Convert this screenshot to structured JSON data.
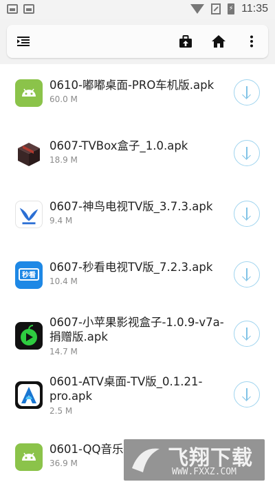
{
  "status_bar": {
    "time": "11:35",
    "battery_glyph": "⚡"
  },
  "toolbar": {
    "menu_icon": "menu-icon",
    "upload_icon": "upload-icon",
    "home_icon": "home-icon",
    "more_icon": "more-vertical-icon"
  },
  "files": [
    {
      "name": "0610-嘟嘟桌面-PRO车机版.apk",
      "size": "60.0 M",
      "icon": "android-icon"
    },
    {
      "name": "0607-TVBox盒子_1.0.apk",
      "size": "18.9 M",
      "icon": "box-icon"
    },
    {
      "name": "0607-神鸟电视TV版_3.7.3.apk",
      "size": "9.4 M",
      "icon": "bird-icon"
    },
    {
      "name": "0607-秒看电视TV版_7.2.3.apk",
      "size": "10.4 M",
      "icon": "tv-icon",
      "icon_text": "秒看"
    },
    {
      "name": "0607-小苹果影视盒子-1.0.9-v7a-捐赠版.apk",
      "size": "14.7 M",
      "icon": "apple-play-icon"
    },
    {
      "name": "0601-ATV桌面-TV版_0.1.21-pro.apk",
      "size": "2.5 M",
      "icon": "atv-icon"
    },
    {
      "name": "0601-QQ音乐",
      "size": "36.9 M",
      "icon": "android-icon"
    }
  ],
  "watermark": {
    "title": "飞翔下载",
    "url": "WWW.FXXZ.COM"
  },
  "colors": {
    "accent": "#7ec2e6",
    "android": "#8bc34a"
  }
}
